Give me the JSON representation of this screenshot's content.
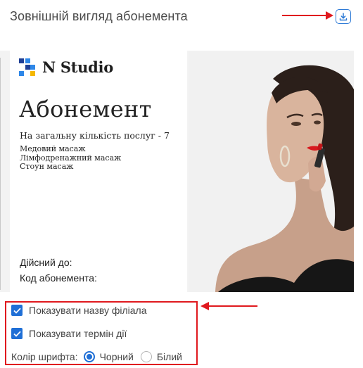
{
  "header": {
    "title": "Зовнішній вигляд абонемента",
    "download_icon": "download-icon"
  },
  "card": {
    "brand_name": "N Studio",
    "title": "Абонемент",
    "services_count_text": "На загальну кількість послуг - 7",
    "services": [
      "Медовий масаж",
      "Лімфодренажний масаж",
      "Стоун масаж"
    ],
    "valid_until_label": "Дійсний до:",
    "code_label": "Код абонемента:"
  },
  "options": {
    "show_branch_name": {
      "label": "Показувати назву філіала",
      "checked": true
    },
    "show_validity": {
      "label": "Показувати термін дії",
      "checked": true
    },
    "font_color": {
      "label": "Колір шрифта:",
      "options": [
        {
          "label": "Чорний",
          "selected": true
        },
        {
          "label": "Білий",
          "selected": false
        }
      ]
    }
  },
  "colors": {
    "accent": "#1f6fd6",
    "annotation": "#e0191e"
  }
}
